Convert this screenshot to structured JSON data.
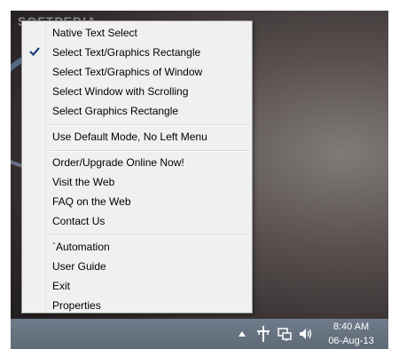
{
  "watermark": "SOFTPEDIA",
  "menu": {
    "items": [
      {
        "label": "Native Text Select"
      },
      {
        "label": "Select Text/Graphics Rectangle",
        "checked": true
      },
      {
        "label": "Select Text/Graphics of Window"
      },
      {
        "label": "Select Window with Scrolling"
      },
      {
        "label": "Select Graphics Rectangle"
      },
      {
        "label": "Use Default Mode, No Left Menu"
      },
      {
        "label": "Order/Upgrade Online Now!"
      },
      {
        "label": "Visit the Web"
      },
      {
        "label": "FAQ on the Web"
      },
      {
        "label": "Contact Us"
      },
      {
        "label": "`Automation"
      },
      {
        "label": "User Guide"
      },
      {
        "label": "Exit"
      },
      {
        "label": "Properties"
      }
    ]
  },
  "taskbar": {
    "tray_icons": [
      "up-arrow-icon",
      "capture-tool-icon",
      "network-icon",
      "volume-icon"
    ],
    "clock": {
      "time": "8:40 AM",
      "date": "06-Aug-13"
    }
  },
  "colors": {
    "menu_bg": "#f0f0f0",
    "taskbar": "#66727f",
    "check": "#1c3f7a"
  }
}
